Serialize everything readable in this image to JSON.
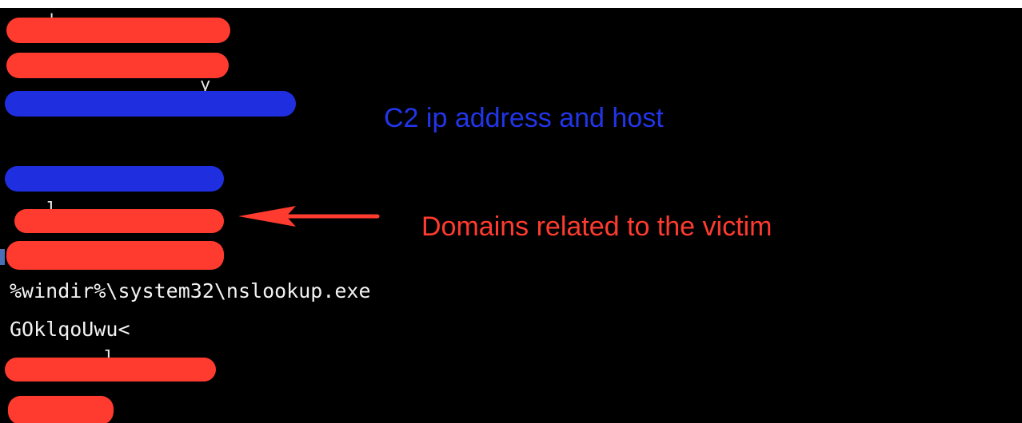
{
  "annotations": {
    "c2": "C2 ip address and host",
    "domains": "Domains related to the victim"
  },
  "terminal_lines": [
    "%windir%\\system32\\nslookup.exe",
    "GOklqoUwu<"
  ],
  "colors": {
    "background": "#000000",
    "redaction_red": "#ff3b30",
    "redaction_blue": "#1f2fe0",
    "annotation_blue": "#2235e8",
    "annotation_red": "#ff3b30",
    "arrow_red": "#ff3b30"
  },
  "icons": {
    "arrow": "arrow-left-icon"
  }
}
